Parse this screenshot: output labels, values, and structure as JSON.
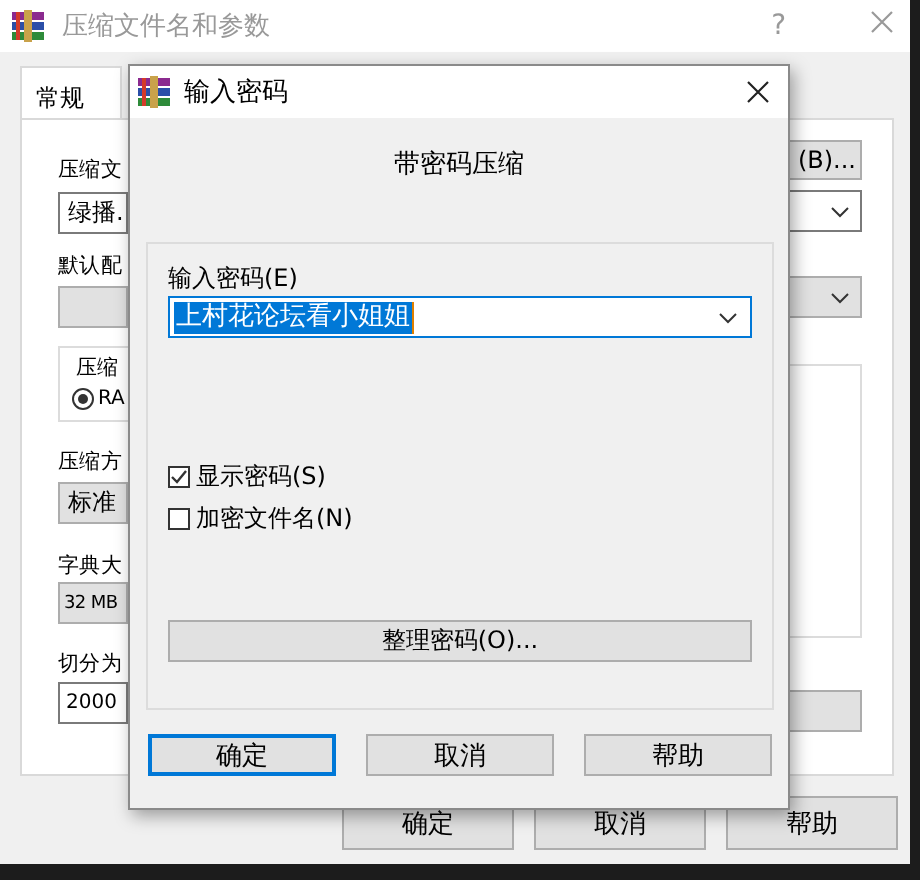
{
  "background_window": {
    "title": "压缩文件名和参数",
    "help_button": "?",
    "tabs": [
      {
        "label": "常规",
        "selected": true
      }
    ],
    "archive_name_label": "压缩文",
    "archive_name": "绿播.",
    "browse_button": "(B)...",
    "default_profile_label": "默认配",
    "format_group_label": "压缩",
    "format_options": [
      {
        "label": "RA",
        "selected": true
      }
    ],
    "method_label": "压缩方",
    "method": "标准",
    "dictionary_label": "字典大",
    "dictionary": "32 MB",
    "split_label": "切分为",
    "split": "2000",
    "buttons": [
      "确定",
      "取消",
      "帮助"
    ]
  },
  "dialog": {
    "title": "输入密码",
    "heading": "带密码压缩",
    "password_label": "输入密码(E)",
    "password": "上村花论坛看小姐姐",
    "password_selected": true,
    "options": [
      {
        "label": "显示密码(S)",
        "checked": true
      },
      {
        "label": "加密文件名(N)",
        "checked": false
      }
    ],
    "organize_button": "整理密码(O)...",
    "buttons": [
      {
        "label": "确定",
        "default": true
      },
      {
        "label": "取消",
        "default": false
      },
      {
        "label": "帮助",
        "default": false
      }
    ]
  }
}
